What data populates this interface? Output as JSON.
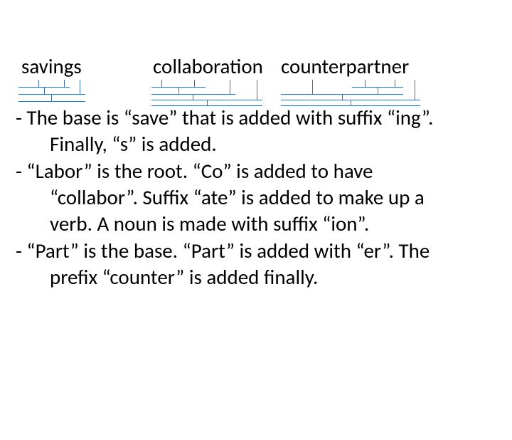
{
  "words": {
    "w1": "savings",
    "w2": "collaboration",
    "w3": "counterpartner"
  },
  "bullets": {
    "b1a": "- The base is “save” that is added with suffix “ing”.",
    "b1b": "Finally, “s” is added.",
    "b2a": "- “Labor” is the root. “Co” is added to have",
    "b2b": "“collabor”. Suffix “ate” is added to make up a",
    "b2c": "verb. A noun is made with suffix “ion”.",
    "b3a": "- “Part” is the base. “Part” is added with “er”. The",
    "b3b": "prefix “counter” is added finally."
  }
}
